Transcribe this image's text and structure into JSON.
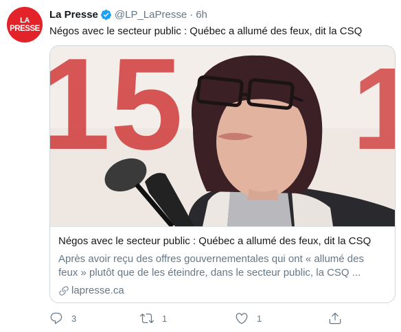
{
  "tweet": {
    "avatar_line1": "LA",
    "avatar_line2": "PRESSE",
    "author_name": "La Presse",
    "handle": "@LP_LaPresse",
    "separator": "·",
    "time": "6h",
    "text": "Négos avec le secteur public : Québec a allumé des feux, dit la CSQ"
  },
  "card": {
    "title": "Négos avec le secteur public : Québec a allumé des feux, dit la CSQ",
    "description": "Après avoir reçu des offres gouvernementales qui ont « allumé des feux » plutôt que de les éteindre, dans le secteur public, la CSQ ...",
    "domain": "lapresse.ca",
    "backdrop_text_left": "15",
    "backdrop_text_right": "1"
  },
  "actions": {
    "reply_count": "3",
    "retweet_count": "1",
    "like_count": "1"
  },
  "icons": {
    "verified": "verified-badge-icon",
    "reply": "reply-icon",
    "retweet": "retweet-icon",
    "like": "heart-icon",
    "share": "share-icon",
    "link": "link-icon"
  },
  "colors": {
    "brand_red": "#e2232a",
    "verified_blue": "#1da1f2",
    "text_primary": "#14171a",
    "text_secondary": "#657786"
  }
}
